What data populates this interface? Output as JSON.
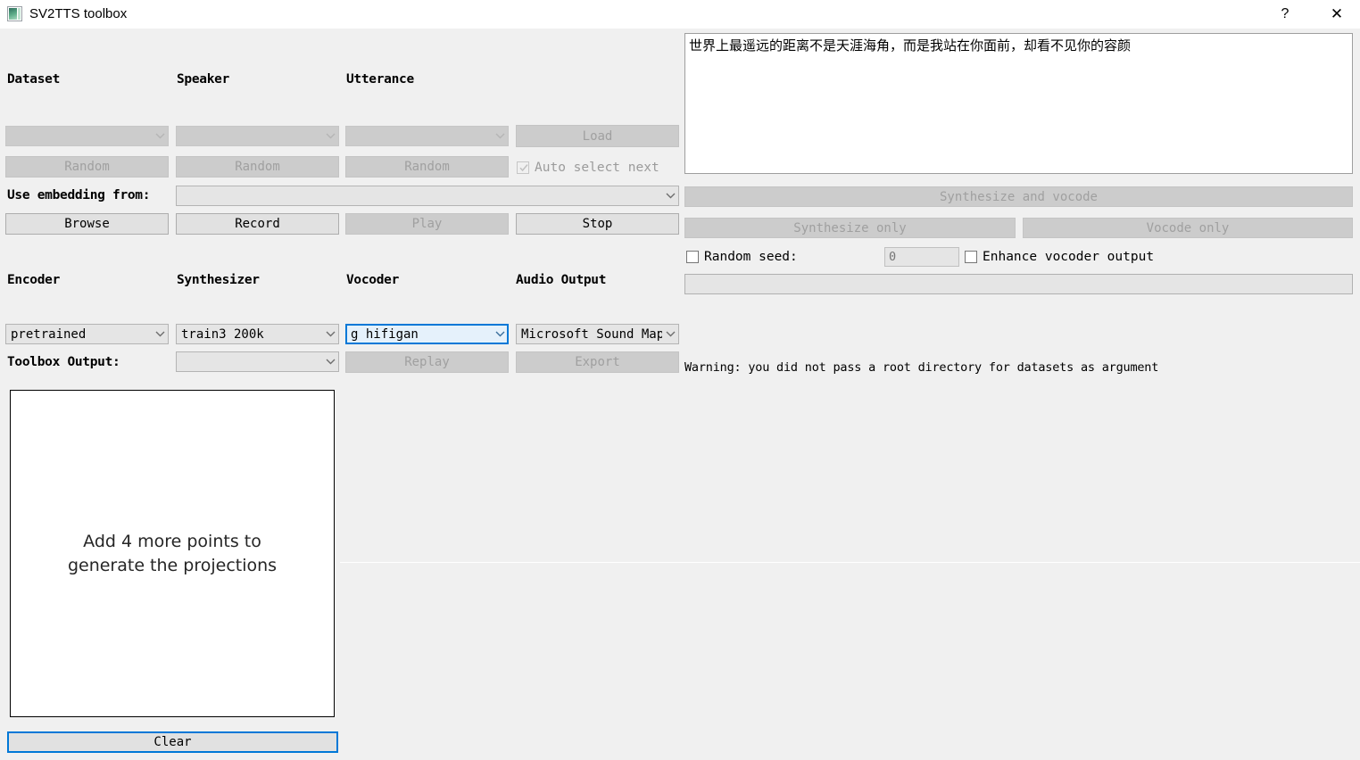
{
  "window": {
    "title": "SV2TTS toolbox",
    "icon": "app-icon",
    "help_label": "?",
    "close_label": "✕"
  },
  "browser": {
    "labels": {
      "dataset": "Dataset",
      "speaker": "Speaker",
      "utterance": "Utterance",
      "use_embedding_from": "Use embedding from:"
    },
    "dataset_combo": {
      "value": "",
      "disabled": true
    },
    "speaker_combo": {
      "value": "",
      "disabled": true
    },
    "utterance_combo": {
      "value": "",
      "disabled": true
    },
    "load_button": {
      "label": "Load",
      "disabled": true
    },
    "random_dataset_button": {
      "label": "Random",
      "disabled": true
    },
    "random_speaker_button": {
      "label": "Random",
      "disabled": true
    },
    "random_utterance_button": {
      "label": "Random",
      "disabled": true
    },
    "auto_select_next": {
      "label": "Auto select next",
      "checked": true,
      "disabled": true
    },
    "embedding_combo": {
      "value": "",
      "disabled": false
    },
    "browse_button": {
      "label": "Browse",
      "disabled": false
    },
    "record_button": {
      "label": "Record",
      "disabled": false
    },
    "play_button": {
      "label": "Play",
      "disabled": true
    },
    "stop_button": {
      "label": "Stop",
      "disabled": false
    }
  },
  "models": {
    "labels": {
      "encoder": "Encoder",
      "synthesizer": "Synthesizer",
      "vocoder": "Vocoder",
      "audio_output": "Audio Output",
      "toolbox_output": "Toolbox Output:"
    },
    "encoder_combo": {
      "value": "pretrained",
      "disabled": false
    },
    "synthesizer_combo": {
      "value": "train3_200k",
      "disabled": false
    },
    "vocoder_combo": {
      "value": "g_hifigan",
      "disabled": false,
      "focused": true
    },
    "audio_output_combo": {
      "value": "Microsoft Sound Mapp",
      "disabled": false
    },
    "toolbox_output_combo": {
      "value": "",
      "disabled": false
    },
    "replay_button": {
      "label": "Replay",
      "disabled": true
    },
    "export_button": {
      "label": "Export",
      "disabled": true
    }
  },
  "generation": {
    "text_input": "世界上最遥远的距离不是天涯海角，而是我站在你面前，却看不见你的容颜",
    "synthesize_and_vocode_button": {
      "label": "Synthesize and vocode",
      "disabled": true
    },
    "synthesize_only_button": {
      "label": "Synthesize only",
      "disabled": true
    },
    "vocode_only_button": {
      "label": "Vocode only",
      "disabled": true
    },
    "random_seed": {
      "label": "Random seed:",
      "checked": false,
      "value": "",
      "placeholder": "0"
    },
    "enhance_vocoder_output": {
      "label": "Enhance vocoder output",
      "checked": false
    },
    "progress_value": ""
  },
  "projection": {
    "message": "Add 4 more points to\ngenerate the projections",
    "clear_button": {
      "label": "Clear",
      "focused": true
    }
  },
  "log": {
    "warning": "Warning: you did not pass a root directory for datasets as argument"
  },
  "colors": {
    "window_bg": "#f0f0f0",
    "accent": "#0078d7",
    "disabled_bg": "#cccccc",
    "disabled_text": "#a0a0a0",
    "button_bg": "#e1e1e1"
  }
}
